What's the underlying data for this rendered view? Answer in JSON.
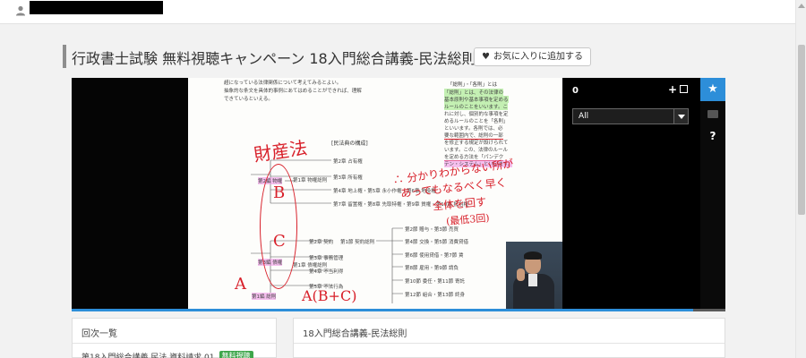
{
  "page": {
    "title": "行政書士試験 無料視聴キャンペーン 18入門総合講義-民法総則",
    "favorite_label": "お気に入りに追加する"
  },
  "player": {
    "panel_count": "0",
    "filter_selected": "All",
    "progress_fraction": 0.95,
    "slide": {
      "line1": "超になっている法律関係について考えてみるとよい。",
      "line2": "抽象的な条文を具体的事例にあてはめることができれば、理解",
      "line3": "できているといえる。",
      "chart_title": "[民法典の構成]",
      "box_title": "「総則」・「各則」とは",
      "box_l1": "「総則」とは、その法律の",
      "box_l2": "基本原則や基本事項を定める",
      "box_l3": "ルールのことをいいます。こ",
      "box_l4": "れに対し、個別的な事項を定",
      "box_l5": "めるルールのことを「各則」",
      "box_l6": "といいます。各則では、必",
      "box_l7": "要な範囲内で、総則の一部",
      "box_l8": "を修正する規定が設けられて",
      "box_l9": "います。この、法律のルール",
      "box_l10": "を定める方法を「パンデク",
      "box_l11": "テン・システム」といいます。",
      "n1": "第2章 占有権",
      "n2": "第3章 所有権",
      "n3": "第4章 地上権・第5章 永小作権・第6章 地役権",
      "n4": "第7章 留置権・第8章 先取特権・第9章 質権・第10章 抵当権",
      "n5": "第1章 物権総則",
      "n6": "第2編 物権",
      "n7": "第2章 契約",
      "n8": "第1節 契約総則",
      "n9": "第3章 事務管理",
      "n10": "第4章 不当利得",
      "n11": "第5章 不法行為",
      "n12": "第3編 債権",
      "n13": "第1章 債権総則",
      "n14": "第1編 総則",
      "r1": "第2節 贈与・第3節 売買",
      "r2": "第4節 交換・第5節 消費貸借",
      "r3": "第6節 使用貸借・第7節 賃",
      "r4": "第8節 雇用・第9節 請負",
      "r5": "第10節 委任・第11節 寄託",
      "r6": "第12節 組合・第13節 終身",
      "hw1": "財産法",
      "hw2": "B",
      "hw3": "C",
      "hw4": "A",
      "hw5": "A(B+C)",
      "hw6": "∴ 分かりわからない所が",
      "hw7": "あってもなるべく早く",
      "hw8": "全体を回す",
      "hw9": "(最低3回)"
    }
  },
  "episode_list": {
    "header": "回次一覧",
    "first_item": "第18入門総合講義 民法 資料請求 01",
    "first_badge": "無料視聴"
  },
  "lecture_info": {
    "header": "18入門総合講義-民法総則"
  },
  "colors": {
    "accent": "#2d8ed9",
    "annotation": "#d8202a",
    "badge": "#3ea64b"
  }
}
